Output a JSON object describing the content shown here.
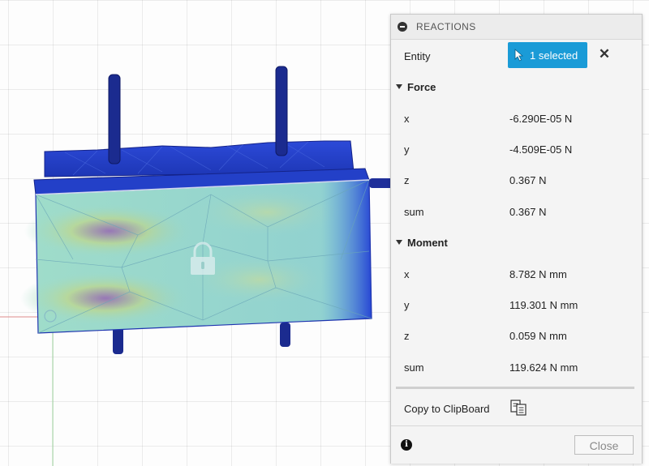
{
  "panel": {
    "title": "REACTIONS",
    "entity_label": "Entity",
    "select_label": "1 selected",
    "clear_glyph": "✕",
    "force": {
      "heading": "Force",
      "rows": [
        {
          "label": "x",
          "value": "-6.290E-05 N"
        },
        {
          "label": "y",
          "value": "-4.509E-05 N"
        },
        {
          "label": "z",
          "value": "0.367 N"
        },
        {
          "label": "sum",
          "value": "0.367 N"
        }
      ]
    },
    "moment": {
      "heading": "Moment",
      "rows": [
        {
          "label": "x",
          "value": "8.782 N mm"
        },
        {
          "label": "y",
          "value": "119.301 N mm"
        },
        {
          "label": "z",
          "value": "0.059 N mm"
        },
        {
          "label": "sum",
          "value": "119.624 N mm"
        }
      ]
    },
    "copy_label": "Copy to ClipBoard",
    "info_glyph": "i",
    "close_label": "Close"
  },
  "icons": {
    "collapse": "collapse-icon",
    "cursor": "cursor-icon",
    "clear": "clear-icon",
    "clipboard": "clipboard-icon",
    "info": "info-icon",
    "lock": "lock-icon"
  },
  "colors": {
    "accent": "#1a9bd7",
    "model_dark": "#1b2b8f",
    "model_mid": "#2446d6",
    "stress_low": "#7fd6d0",
    "stress_high": "#a07bb8"
  }
}
